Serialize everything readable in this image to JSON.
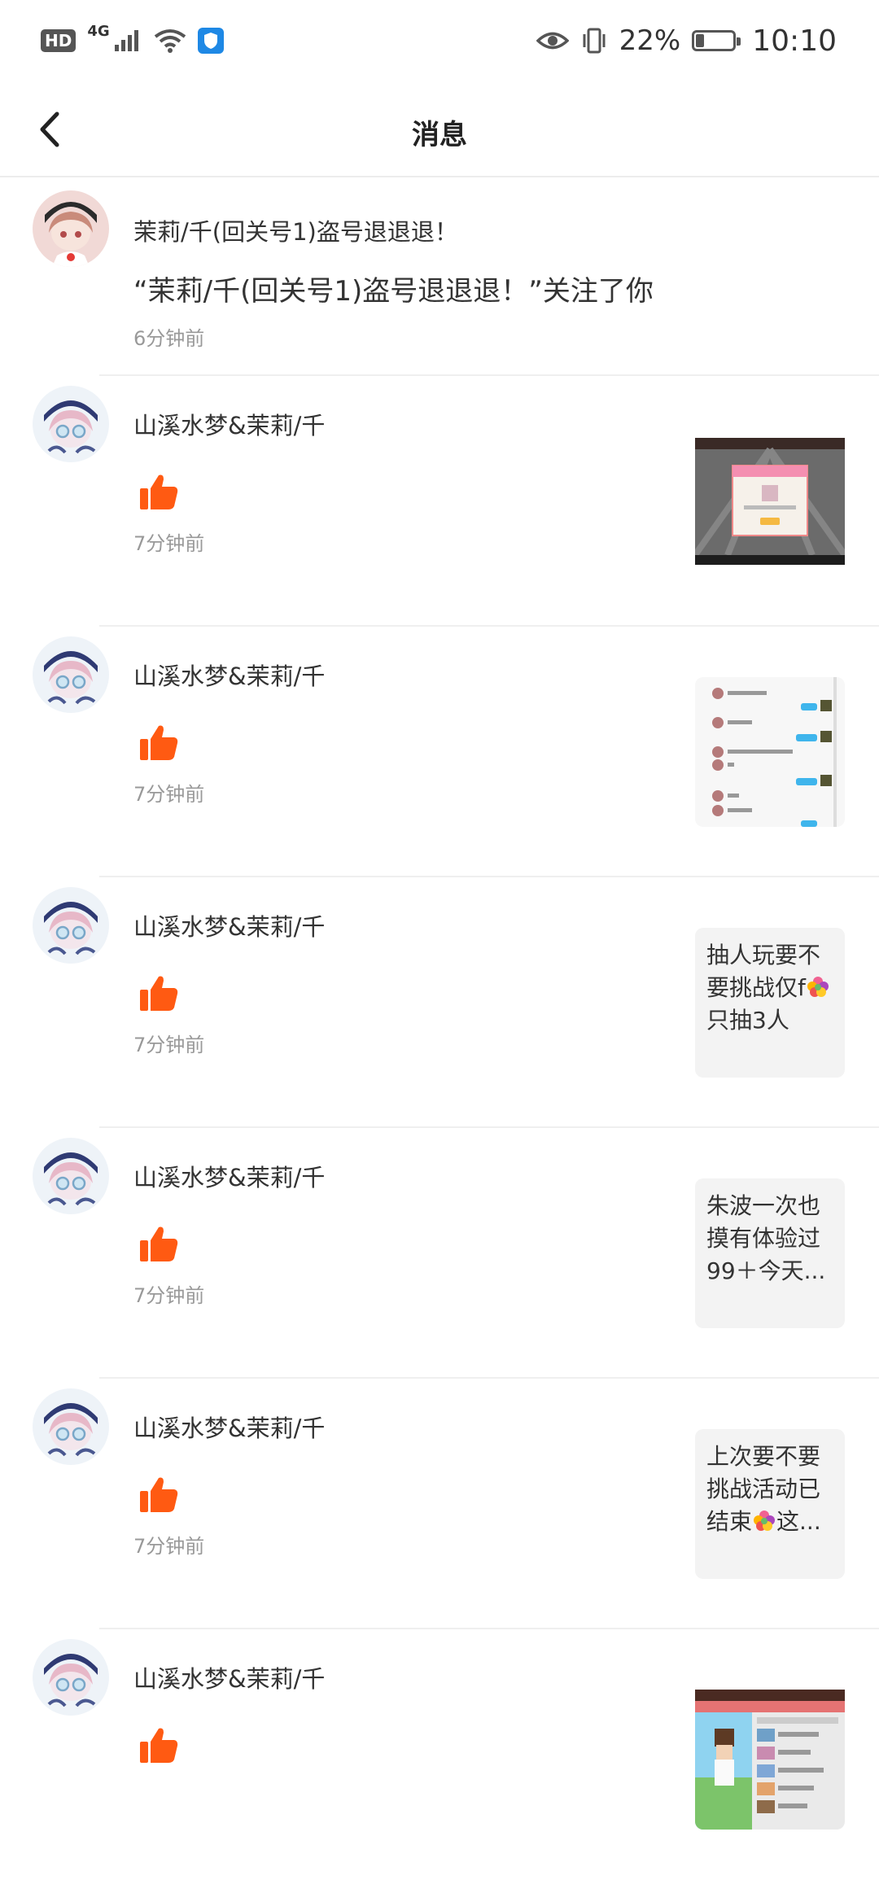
{
  "status_bar": {
    "hd": "HD",
    "network": "4G",
    "battery": "22%",
    "battery_level": 0.22,
    "time": "10:10"
  },
  "header": {
    "title": "消息",
    "back_icon": "chevron-left-icon"
  },
  "colors": {
    "like": "#ff5a12",
    "divider": "#efefef",
    "time": "#999999"
  },
  "messages": [
    {
      "type": "follow",
      "name": "茉莉/千(回关号1)盗号退退退！",
      "text": "“茉莉/千(回关号1)盗号退退退！”关注了你",
      "time": "6分钟前"
    },
    {
      "type": "like",
      "name": "山溪水梦&茉莉/千",
      "time": "7分钟前",
      "thumb": "image"
    },
    {
      "type": "like",
      "name": "山溪水梦&茉莉/千",
      "time": "7分钟前",
      "thumb": "image"
    },
    {
      "type": "like",
      "name": "山溪水梦&茉莉/千",
      "time": "7分钟前",
      "thumb_text_1": "抽人玩要不要挑战仅f",
      "thumb_text_2": "只抽3人"
    },
    {
      "type": "like",
      "name": "山溪水梦&茉莉/千",
      "time": "7分钟前",
      "thumb_text_1": "朱波一次也摸有体验过99＋今天..."
    },
    {
      "type": "like",
      "name": "山溪水梦&茉莉/千",
      "time": "7分钟前",
      "thumb_text_1": "上次要不要挑战活动已结束",
      "thumb_text_2": "这..."
    },
    {
      "type": "like",
      "name": "山溪水梦&茉莉/千",
      "time": "",
      "thumb": "image"
    }
  ]
}
